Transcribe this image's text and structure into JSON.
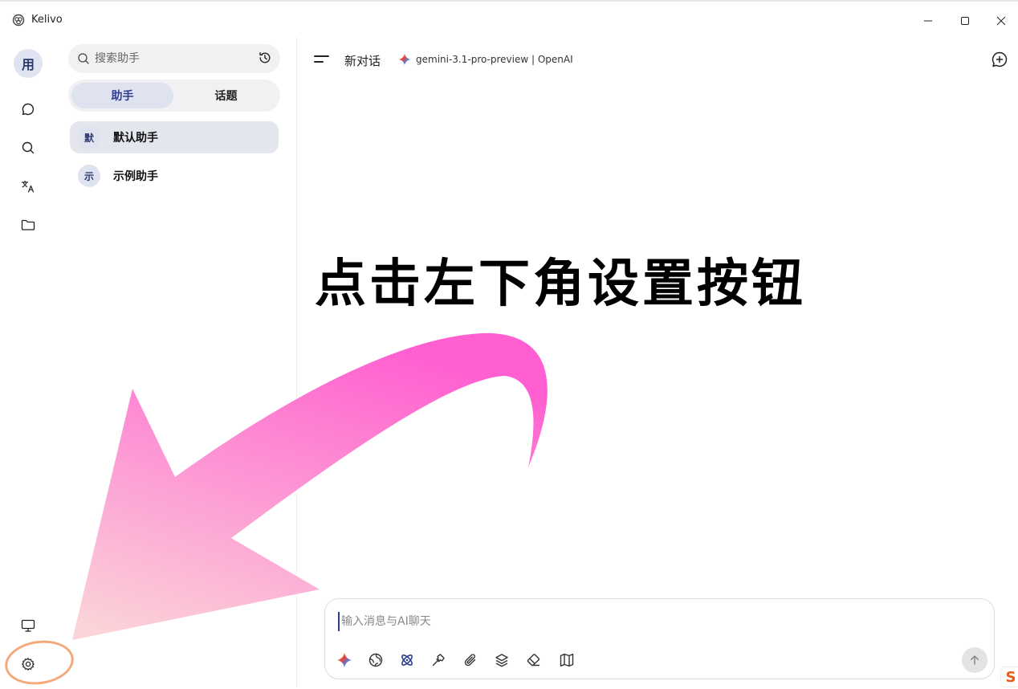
{
  "window": {
    "title": "Kelivo",
    "controls": [
      "minimize",
      "maximize",
      "close"
    ]
  },
  "rail": {
    "avatar_text": "用",
    "icons": [
      "chat-icon",
      "search-icon",
      "translate-icon",
      "folder-icon",
      "display-icon",
      "settings-icon"
    ]
  },
  "sidebar": {
    "search_placeholder": "搜索助手",
    "tabs": [
      {
        "label": "助手",
        "active": true
      },
      {
        "label": "话题",
        "active": false
      }
    ],
    "assistants": [
      {
        "avatar": "默",
        "name": "默认助手",
        "selected": true
      },
      {
        "avatar": "示",
        "name": "示例助手",
        "selected": false
      }
    ]
  },
  "header": {
    "conversation_title": "新对话",
    "model_label": "gemini-3.1-pro-preview | OpenAI"
  },
  "overlay": {
    "instruction": "点击左下角设置按钮",
    "arrow_color_top": "#ff5fd0",
    "arrow_color_bottom": "#fbd4d8",
    "highlight_color": "#f3a97b"
  },
  "composer": {
    "placeholder": "输入消息与AI聊天",
    "tools": [
      "sparkle-icon",
      "globe-icon",
      "atom-icon",
      "hammer-icon",
      "paperclip-icon",
      "layers-icon",
      "eraser-icon",
      "map-icon"
    ]
  },
  "corner_badge": "S"
}
